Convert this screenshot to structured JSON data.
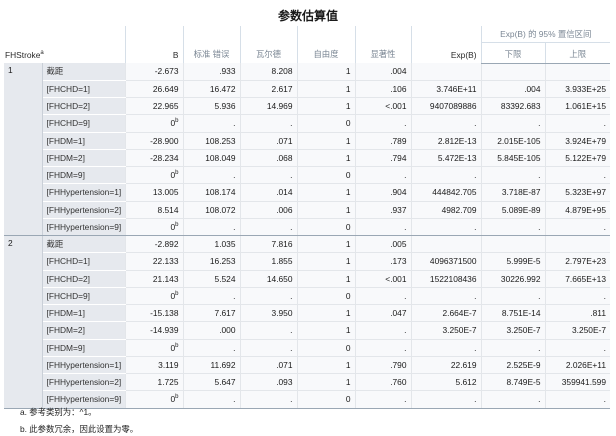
{
  "title": "参数估算值",
  "headers": {
    "row_label": "FHStroke",
    "row_label_sup": "a",
    "b": "B",
    "se": "标准 错误",
    "wald": "瓦尔德",
    "df": "自由度",
    "sig": "显著性",
    "exp": "Exp(B)",
    "ci_group": "Exp(B) 的 95% 置信区间",
    "ci_lower": "下限",
    "ci_upper": "上限"
  },
  "groups": [
    {
      "model": "1",
      "rows": [
        {
          "param": "截距",
          "b": "-2.673",
          "b_sup": "",
          "se": ".933",
          "wald": "8.208",
          "df": "1",
          "sig": ".004",
          "exp": "",
          "lo": "",
          "hi": ""
        },
        {
          "param": "[FHCHD=1]",
          "b": "26.649",
          "b_sup": "",
          "se": "16.472",
          "wald": "2.617",
          "df": "1",
          "sig": ".106",
          "exp": "3.746E+11",
          "lo": ".004",
          "hi": "3.933E+25"
        },
        {
          "param": "[FHCHD=2]",
          "b": "22.965",
          "b_sup": "",
          "se": "5.936",
          "wald": "14.969",
          "df": "1",
          "sig": "<.001",
          "exp": "9407089886",
          "lo": "83392.683",
          "hi": "1.061E+15"
        },
        {
          "param": "[FHCHD=9]",
          "b": "0",
          "b_sup": "b",
          "se": ".",
          "wald": ".",
          "df": "0",
          "sig": ".",
          "exp": ".",
          "lo": ".",
          "hi": "."
        },
        {
          "param": "[FHDM=1]",
          "b": "-28.900",
          "b_sup": "",
          "se": "108.253",
          "wald": ".071",
          "df": "1",
          "sig": ".789",
          "exp": "2.812E-13",
          "lo": "2.015E-105",
          "hi": "3.924E+79"
        },
        {
          "param": "[FHDM=2]",
          "b": "-28.234",
          "b_sup": "",
          "se": "108.049",
          "wald": ".068",
          "df": "1",
          "sig": ".794",
          "exp": "5.472E-13",
          "lo": "5.845E-105",
          "hi": "5.122E+79"
        },
        {
          "param": "[FHDM=9]",
          "b": "0",
          "b_sup": "b",
          "se": ".",
          "wald": ".",
          "df": "0",
          "sig": ".",
          "exp": ".",
          "lo": ".",
          "hi": "."
        },
        {
          "param": "[FHHypertension=1]",
          "b": "13.005",
          "b_sup": "",
          "se": "108.174",
          "wald": ".014",
          "df": "1",
          "sig": ".904",
          "exp": "444842.705",
          "lo": "3.718E-87",
          "hi": "5.323E+97"
        },
        {
          "param": "[FHHypertension=2]",
          "b": "8.514",
          "b_sup": "",
          "se": "108.072",
          "wald": ".006",
          "df": "1",
          "sig": ".937",
          "exp": "4982.709",
          "lo": "5.089E-89",
          "hi": "4.879E+95"
        },
        {
          "param": "[FHHypertension=9]",
          "b": "0",
          "b_sup": "b",
          "se": ".",
          "wald": ".",
          "df": "0",
          "sig": ".",
          "exp": ".",
          "lo": ".",
          "hi": "."
        }
      ]
    },
    {
      "model": "2",
      "rows": [
        {
          "param": "截距",
          "b": "-2.892",
          "b_sup": "",
          "se": "1.035",
          "wald": "7.816",
          "df": "1",
          "sig": ".005",
          "exp": "",
          "lo": "",
          "hi": ""
        },
        {
          "param": "[FHCHD=1]",
          "b": "22.133",
          "b_sup": "",
          "se": "16.253",
          "wald": "1.855",
          "df": "1",
          "sig": ".173",
          "exp": "4096371500",
          "lo": "5.999E-5",
          "hi": "2.797E+23"
        },
        {
          "param": "[FHCHD=2]",
          "b": "21.143",
          "b_sup": "",
          "se": "5.524",
          "wald": "14.650",
          "df": "1",
          "sig": "<.001",
          "exp": "1522108436",
          "lo": "30226.992",
          "hi": "7.665E+13"
        },
        {
          "param": "[FHCHD=9]",
          "b": "0",
          "b_sup": "b",
          "se": ".",
          "wald": ".",
          "df": "0",
          "sig": ".",
          "exp": ".",
          "lo": ".",
          "hi": "."
        },
        {
          "param": "[FHDM=1]",
          "b": "-15.138",
          "b_sup": "",
          "se": "7.617",
          "wald": "3.950",
          "df": "1",
          "sig": ".047",
          "exp": "2.664E-7",
          "lo": "8.751E-14",
          "hi": ".811"
        },
        {
          "param": "[FHDM=2]",
          "b": "-14.939",
          "b_sup": "",
          "se": ".000",
          "wald": ".",
          "df": "1",
          "sig": ".",
          "exp": "3.250E-7",
          "lo": "3.250E-7",
          "hi": "3.250E-7"
        },
        {
          "param": "[FHDM=9]",
          "b": "0",
          "b_sup": "b",
          "se": ".",
          "wald": ".",
          "df": "0",
          "sig": ".",
          "exp": ".",
          "lo": ".",
          "hi": "."
        },
        {
          "param": "[FHHypertension=1]",
          "b": "3.119",
          "b_sup": "",
          "se": "11.692",
          "wald": ".071",
          "df": "1",
          "sig": ".790",
          "exp": "22.619",
          "lo": "2.525E-9",
          "hi": "2.026E+11"
        },
        {
          "param": "[FHHypertension=2]",
          "b": "1.725",
          "b_sup": "",
          "se": "5.647",
          "wald": ".093",
          "df": "1",
          "sig": ".760",
          "exp": "5.612",
          "lo": "8.749E-5",
          "hi": "359941.599"
        },
        {
          "param": "[FHHypertension=9]",
          "b": "0",
          "b_sup": "b",
          "se": ".",
          "wald": ".",
          "df": "0",
          "sig": ".",
          "exp": ".",
          "lo": ".",
          "hi": "."
        }
      ]
    }
  ],
  "footnotes": [
    "a. 参考类别为：^1。",
    "b. 此参数冗余，因此设置为零。"
  ]
}
